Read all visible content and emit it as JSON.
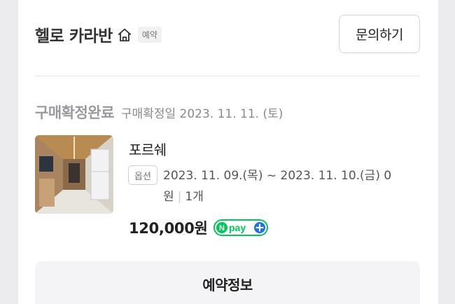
{
  "shop": {
    "name": "헬로 카라반",
    "badge": "예약",
    "inquiry_label": "문의하기"
  },
  "order": {
    "status": "구매확정완료",
    "confirm_date": "구매확정일 2023. 11. 11. (토)",
    "product_name": "포르쉐",
    "option_label": "옵션",
    "option_value": "2023. 11. 09.(목) ~ 2023. 11. 10.(금) 0원",
    "quantity": "1개",
    "price": "120,000원",
    "payment_badge": "pay"
  },
  "actions": {
    "reservation_info_label": "예약정보"
  },
  "colors": {
    "npay_green": "#03c75a",
    "npay_blue": "#1e6fe0"
  }
}
